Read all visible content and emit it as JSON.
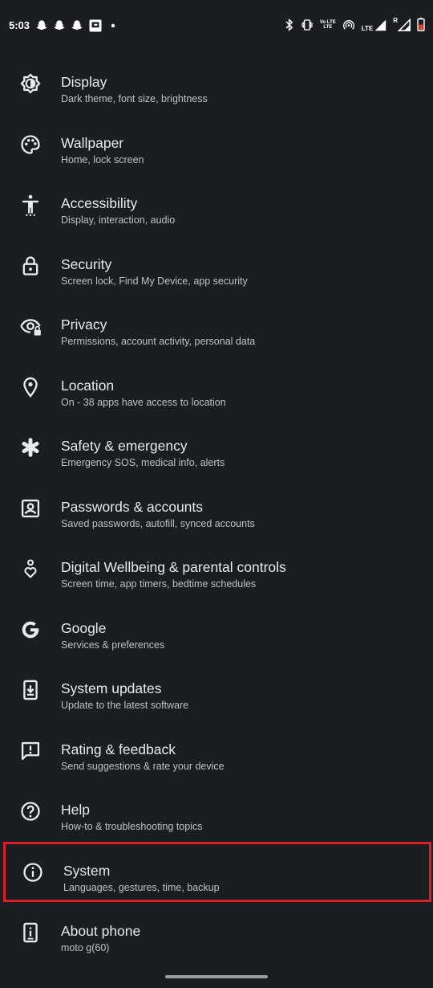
{
  "status_bar": {
    "time": "5:03",
    "volte_label": "Vo LTE",
    "lte_label": "LTE",
    "r_label": "R"
  },
  "settings": [
    {
      "id": "display",
      "title": "Display",
      "subtitle": "Dark theme, font size, brightness",
      "icon": "brightness-icon"
    },
    {
      "id": "wallpaper",
      "title": "Wallpaper",
      "subtitle": "Home, lock screen",
      "icon": "palette-icon"
    },
    {
      "id": "accessibility",
      "title": "Accessibility",
      "subtitle": "Display, interaction, audio",
      "icon": "accessibility-icon"
    },
    {
      "id": "security",
      "title": "Security",
      "subtitle": "Screen lock, Find My Device, app security",
      "icon": "lock-icon"
    },
    {
      "id": "privacy",
      "title": "Privacy",
      "subtitle": "Permissions, account activity, personal data",
      "icon": "privacy-eye-icon"
    },
    {
      "id": "location",
      "title": "Location",
      "subtitle": "On - 38 apps have access to location",
      "icon": "location-pin-icon"
    },
    {
      "id": "safety",
      "title": "Safety & emergency",
      "subtitle": "Emergency SOS, medical info, alerts",
      "icon": "asterisk-icon"
    },
    {
      "id": "passwords",
      "title": "Passwords & accounts",
      "subtitle": "Saved passwords, autofill, synced accounts",
      "icon": "account-box-icon"
    },
    {
      "id": "wellbeing",
      "title": "Digital Wellbeing & parental controls",
      "subtitle": "Screen time, app timers, bedtime schedules",
      "icon": "wellbeing-icon"
    },
    {
      "id": "google",
      "title": "Google",
      "subtitle": "Services & preferences",
      "icon": "google-g-icon"
    },
    {
      "id": "system-updates",
      "title": "System updates",
      "subtitle": "Update to the latest software",
      "icon": "system-update-icon"
    },
    {
      "id": "rating",
      "title": "Rating & feedback",
      "subtitle": "Send suggestions & rate your device",
      "icon": "feedback-icon"
    },
    {
      "id": "help",
      "title": "Help",
      "subtitle": "How-to & troubleshooting topics",
      "icon": "help-circle-icon"
    },
    {
      "id": "system",
      "title": "System",
      "subtitle": "Languages, gestures, time, backup",
      "icon": "info-circle-icon"
    },
    {
      "id": "about",
      "title": "About phone",
      "subtitle": "moto g(60)",
      "icon": "phone-info-icon"
    }
  ],
  "colors": {
    "background": "#1b1d21",
    "highlight_border": "#d8202a",
    "title_text": "#e8eaed",
    "subtitle_text": "#bdc1c6",
    "battery_low": "#e8402c"
  }
}
